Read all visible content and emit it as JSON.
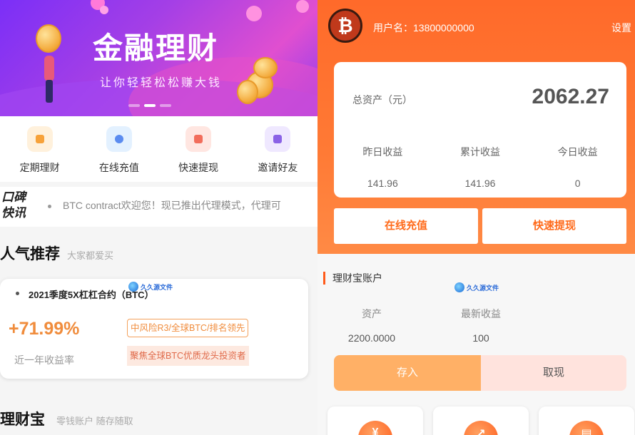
{
  "left": {
    "banner": {
      "title": "金融理财",
      "subtitle": "让你轻轻松松赚大钱",
      "page_count": 3,
      "active_page": 2
    },
    "quick_menu": [
      {
        "label": "定期理财",
        "icon": "calendar-money-icon",
        "color": "#f7a23a",
        "bg": "#fff1dc"
      },
      {
        "label": "在线充值",
        "icon": "user-recharge-icon",
        "color": "#5b8cf0",
        "bg": "#e3f1ff"
      },
      {
        "label": "快速提现",
        "icon": "withdraw-doc-icon",
        "color": "#f26d5b",
        "bg": "#ffe6e1"
      },
      {
        "label": "邀请好友",
        "icon": "invite-wallet-icon",
        "color": "#8a62e6",
        "bg": "#efe8ff"
      }
    ],
    "notice": {
      "logo_line1": "口碑",
      "logo_line2": "快讯",
      "text": "BTC contract欢迎您！现已推出代理模式，代理可"
    },
    "popular": {
      "title": "人气推荐",
      "subtitle": "大家都爱买"
    },
    "product": {
      "name": "2021季度5X杠杠合约（BTC）",
      "rate": "+71.99%",
      "rate_label": "近一年收益率",
      "tag_risk": "中风险R3/全球BTC/排名领先",
      "tag_focus": "聚焦全球BTC优质龙头投资者"
    },
    "wallet_section": {
      "title": "理财宝",
      "subtitle": "零钱账户 随存随取"
    },
    "watermark_text": "久久源文件"
  },
  "right": {
    "header": {
      "username": "用户名：13800000000",
      "settings": "设置"
    },
    "assets": {
      "total_label": "总资产（元）",
      "total_value": "2062.27",
      "stats": [
        {
          "label": "昨日收益",
          "value": "141.96"
        },
        {
          "label": "累计收益",
          "value": "141.96"
        },
        {
          "label": "今日收益",
          "value": "0"
        }
      ]
    },
    "buttons": {
      "recharge": "在线充值",
      "withdraw": "快速提现"
    },
    "wallet": {
      "title": "理财宝账户",
      "asset_label": "资产",
      "asset_value": "2200.0000",
      "earning_label": "最新收益",
      "earning_value": "100",
      "save": "存入",
      "draw": "取现"
    },
    "watermark_text": "久久源文件"
  },
  "colors": {
    "brand_orange": "#ff6a2a",
    "rate_orange": "#f08c3c",
    "banner_purple": "#7b2ff7"
  }
}
